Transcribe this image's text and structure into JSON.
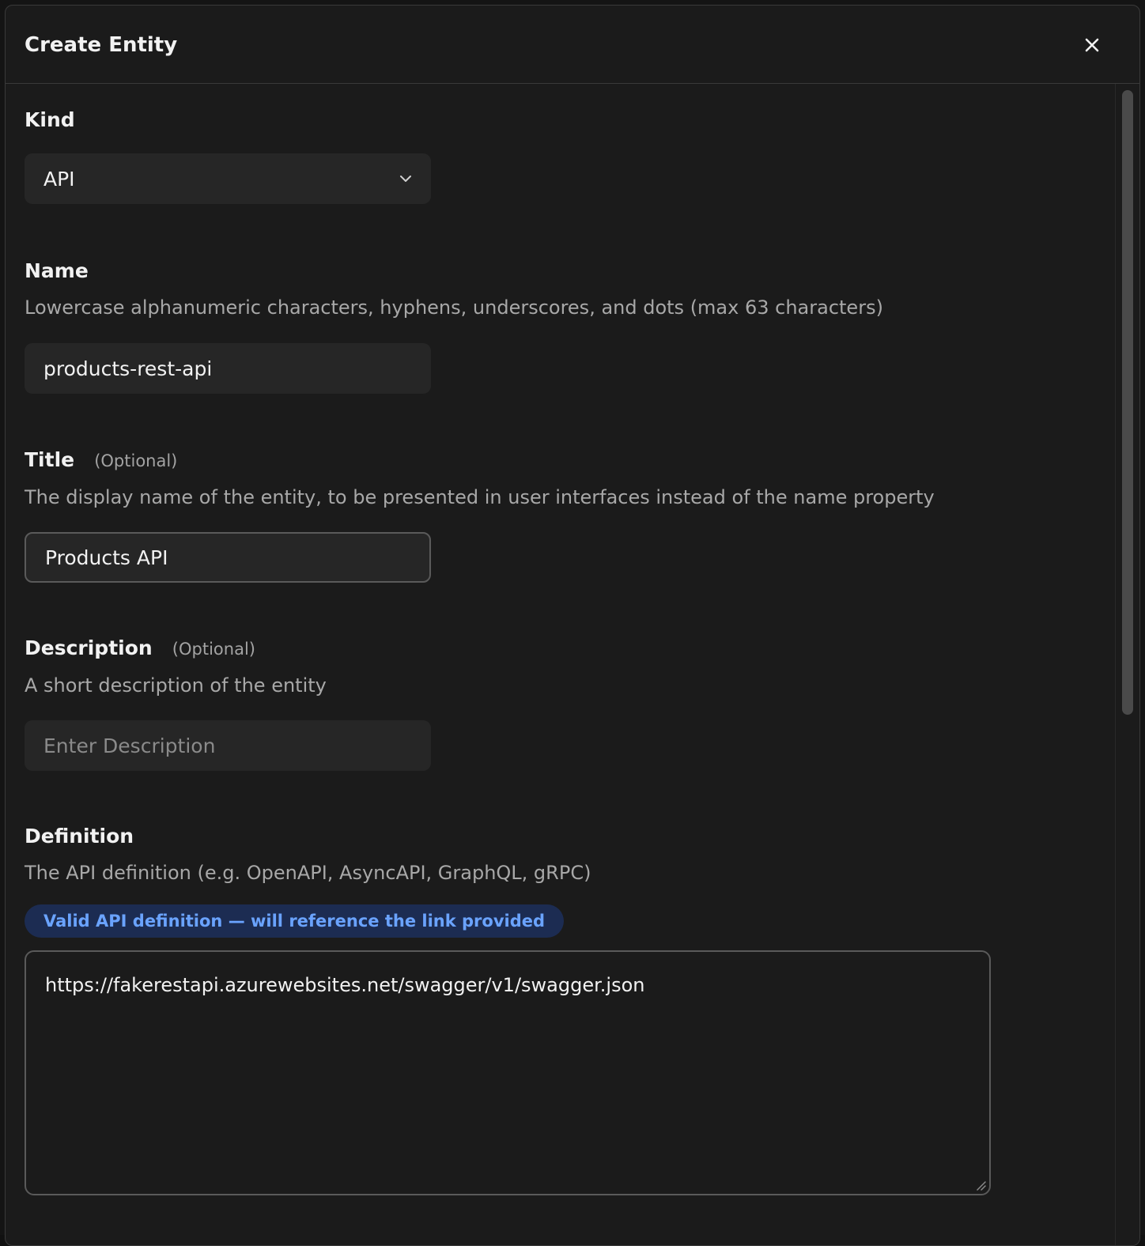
{
  "dialog": {
    "title": "Create Entity",
    "close_icon": "close-icon"
  },
  "form": {
    "kind": {
      "label": "Kind",
      "value": "API"
    },
    "name": {
      "label": "Name",
      "help": "Lowercase alphanumeric characters, hyphens, underscores, and dots (max 63 characters)",
      "value": "products-rest-api"
    },
    "title": {
      "label": "Title",
      "optional": "(Optional)",
      "help": "The display name of the entity, to be presented in user interfaces instead of the name property",
      "value": "Products API"
    },
    "description": {
      "label": "Description",
      "optional": "(Optional)",
      "help": "A short description of the entity",
      "placeholder": "Enter Description"
    },
    "definition": {
      "label": "Definition",
      "help": "The API definition (e.g. OpenAPI, AsyncAPI, GraphQL, gRPC)",
      "badge": "Valid API definition — will reference the link provided",
      "value": "https://fakerestapi.azurewebsites.net/swagger/v1/swagger.json"
    }
  },
  "colors": {
    "background": "#1b1b1b",
    "input": "#262626",
    "border": "#5a5a5a",
    "badge_bg": "#1c2c52",
    "badge_text": "#6aa3ff"
  }
}
